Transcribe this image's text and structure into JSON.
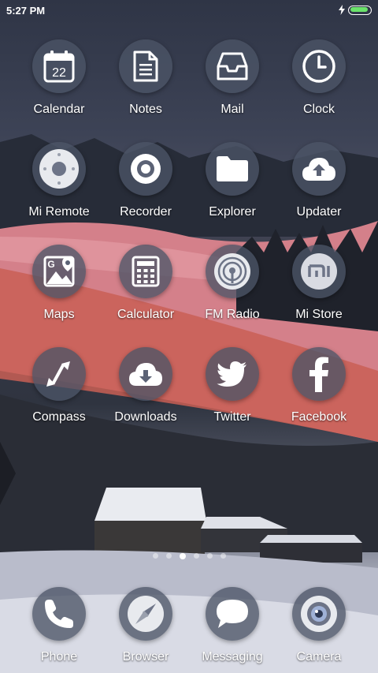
{
  "status_bar": {
    "time": "5:27 PM",
    "battery_level": 0.95,
    "battery_color": "#6be36b",
    "charging": true
  },
  "apps": [
    {
      "label": "Calendar",
      "icon": "calendar-icon",
      "calendar_day": "22"
    },
    {
      "label": "Notes",
      "icon": "notes-icon"
    },
    {
      "label": "Mail",
      "icon": "mail-icon"
    },
    {
      "label": "Clock",
      "icon": "clock-icon"
    },
    {
      "label": "Mi Remote",
      "icon": "remote-icon"
    },
    {
      "label": "Recorder",
      "icon": "recorder-icon"
    },
    {
      "label": "Explorer",
      "icon": "folder-icon"
    },
    {
      "label": "Updater",
      "icon": "cloud-upload-icon"
    },
    {
      "label": "Maps",
      "icon": "maps-icon"
    },
    {
      "label": "Calculator",
      "icon": "calculator-icon"
    },
    {
      "label": "FM Radio",
      "icon": "radio-icon"
    },
    {
      "label": "Mi Store",
      "icon": "mi-store-icon"
    },
    {
      "label": "Compass",
      "icon": "compass-icon"
    },
    {
      "label": "Downloads",
      "icon": "cloud-download-icon"
    },
    {
      "label": "Twitter",
      "icon": "twitter-icon"
    },
    {
      "label": "Facebook",
      "icon": "facebook-icon"
    }
  ],
  "page_indicator": {
    "pages": 6,
    "current": 2
  },
  "dock": [
    {
      "label": "Phone",
      "icon": "phone-icon"
    },
    {
      "label": "Browser",
      "icon": "browser-icon"
    },
    {
      "label": "Messaging",
      "icon": "messaging-icon"
    },
    {
      "label": "Camera",
      "icon": "camera-icon"
    }
  ],
  "colors": {
    "icon_background": "#4c5466",
    "icon_glyph": "#ffffff",
    "label_text": "#ffffff"
  }
}
